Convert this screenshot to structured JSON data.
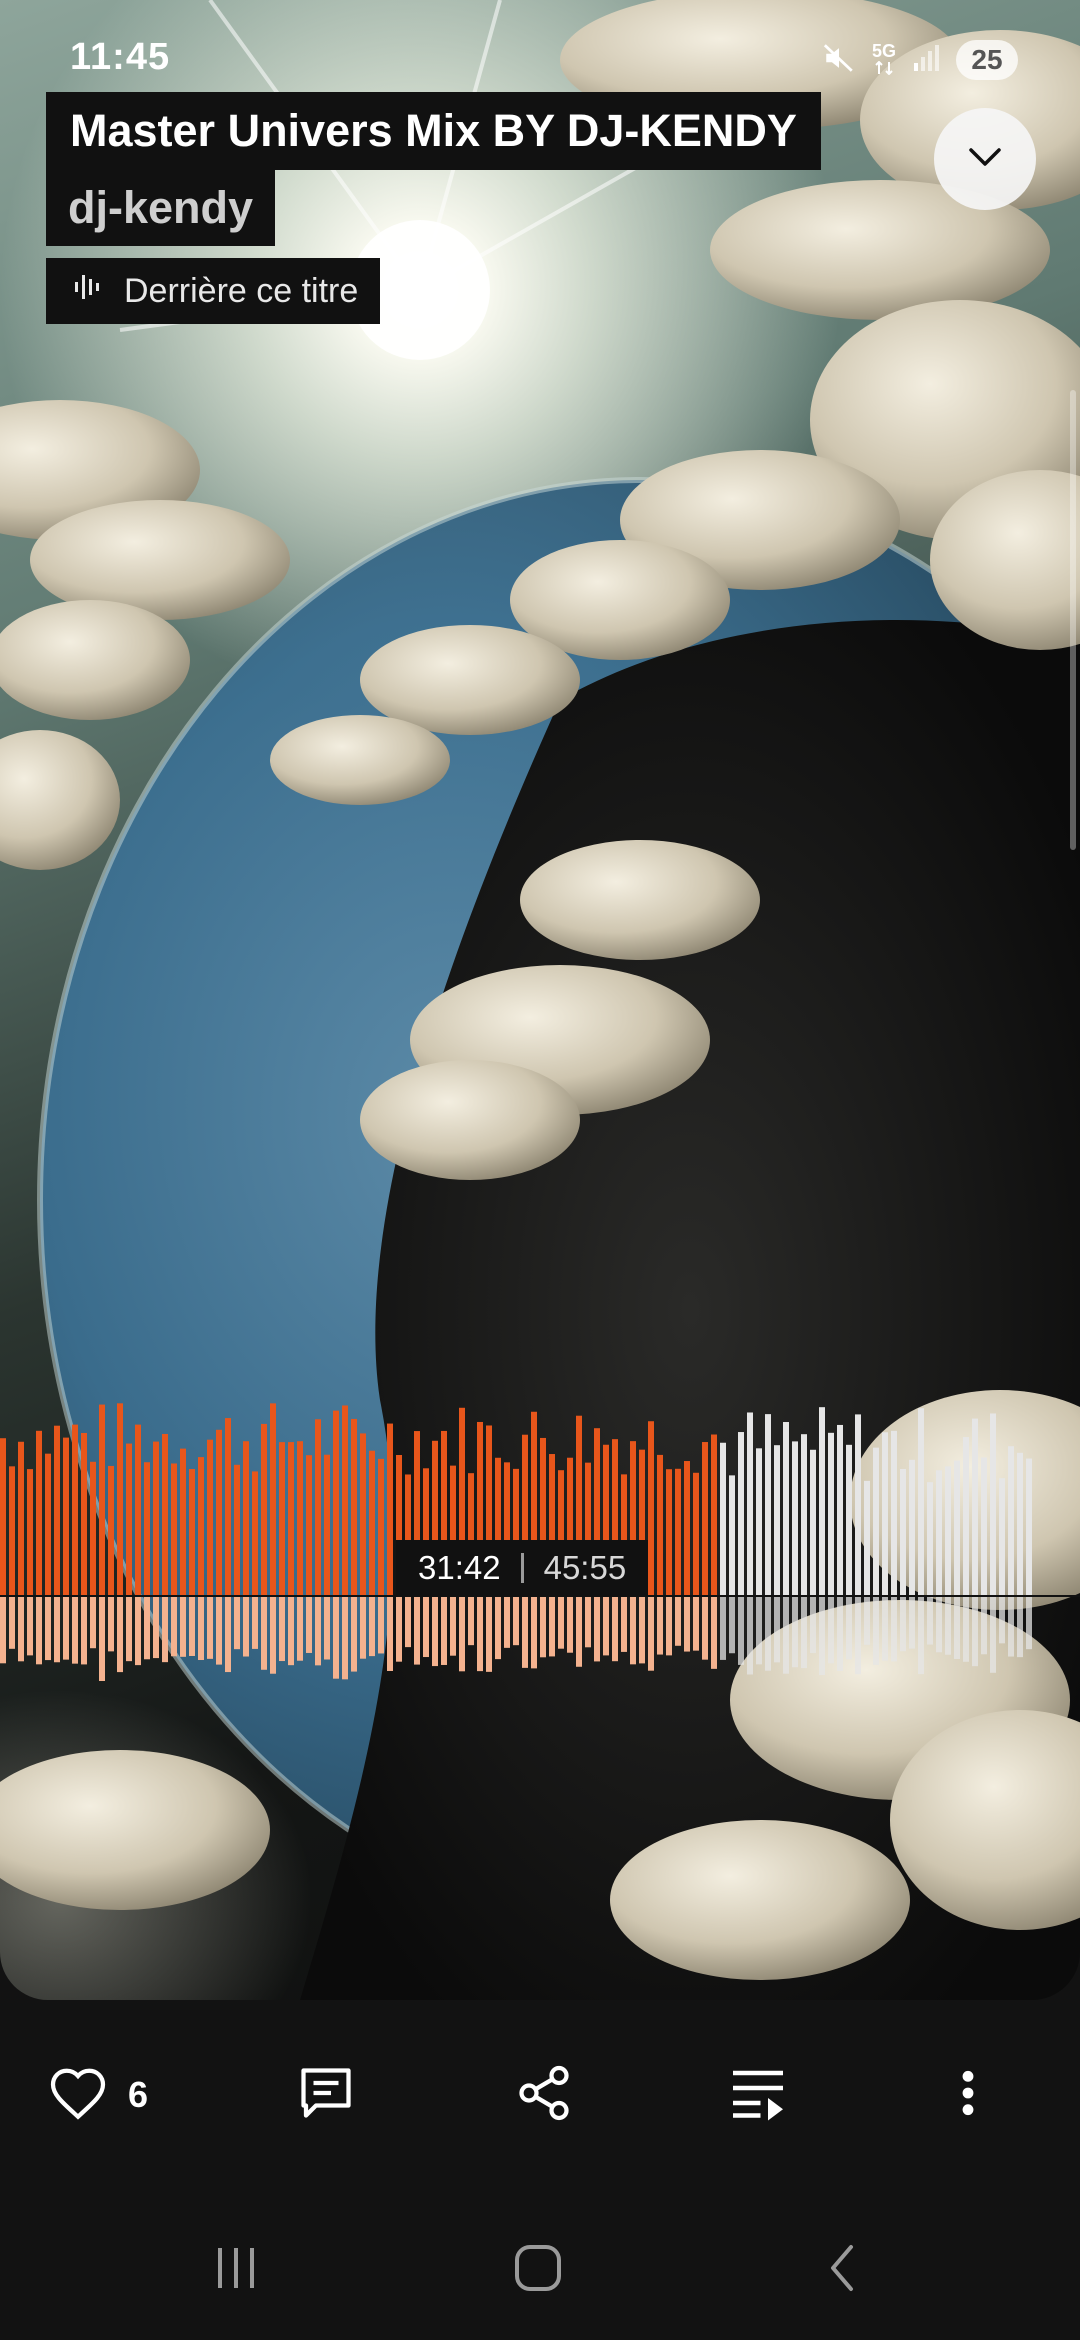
{
  "status_bar": {
    "time": "11:45",
    "network": "5G",
    "battery": "25"
  },
  "track": {
    "title": "Master Univers Mix BY DJ-KENDY",
    "artist": "dj-kendy",
    "behind_label": "Derrière ce titre"
  },
  "player": {
    "elapsed": "31:42",
    "duration": "45:55",
    "progress": 0.69,
    "played_color": "#e8561b",
    "played_reflection_color": "#f4b28f",
    "unplayed_color": "#e6e6e6"
  },
  "actions": {
    "likes": "6",
    "icons": [
      "heart-icon",
      "comment-icon",
      "share-icon",
      "queue-icon",
      "more-icon"
    ]
  },
  "navigation": {
    "icons": [
      "recent-apps-icon",
      "home-icon",
      "back-icon"
    ]
  }
}
